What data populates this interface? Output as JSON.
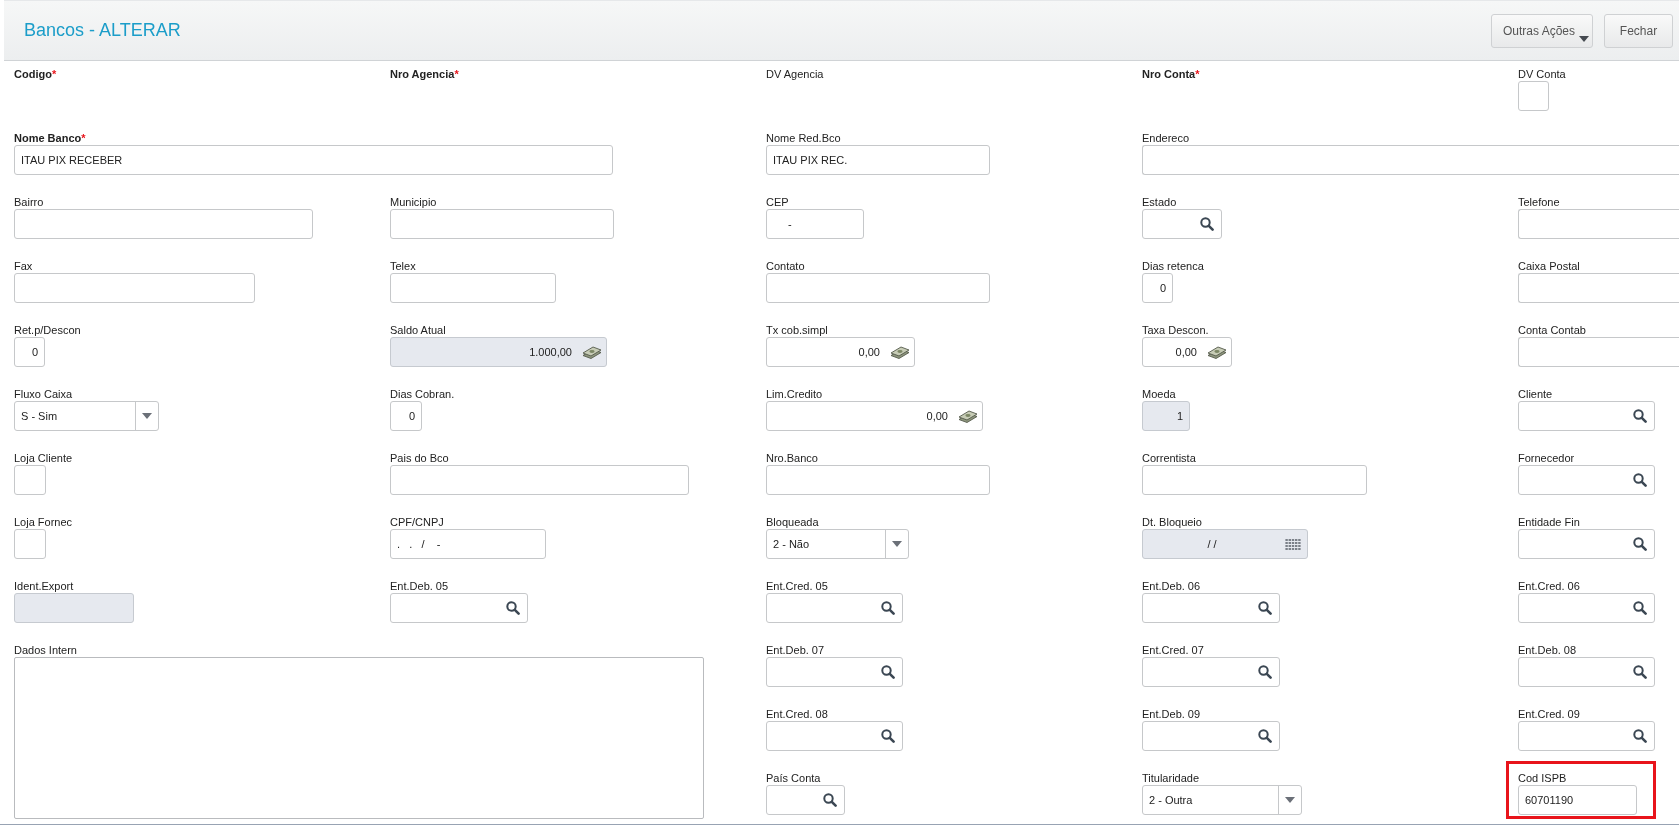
{
  "header": {
    "title": "Bancos - ALTERAR",
    "buttons": [
      {
        "label": "Outras Ações",
        "kind": "menu"
      },
      {
        "label": "Fechar",
        "kind": "plain"
      }
    ]
  },
  "form": {
    "fields": [
      {
        "label": "Codigo",
        "required_mark": "*",
        "kind": "none"
      },
      {
        "label": "Nro Agencia",
        "required_mark": "*",
        "kind": "none"
      },
      {
        "label": "DV Agencia",
        "kind": "none"
      },
      {
        "label": "Nro Conta",
        "required_mark": "*",
        "kind": "none"
      },
      {
        "label": "DV Conta",
        "kind": "text",
        "disabled": false
      },
      {
        "label": "Nome Banco",
        "required_mark": "*",
        "kind": "text",
        "value": "ITAU PIX RECEBER",
        "disabled": false
      },
      {
        "label": "Nome Red.Bco",
        "kind": "text",
        "value": "ITAU PIX REC.",
        "disabled": false
      },
      {
        "label": "Endereco",
        "kind": "text",
        "disabled": false
      },
      {
        "label": "Bairro",
        "kind": "text",
        "disabled": false
      },
      {
        "label": "Municipio",
        "kind": "text",
        "disabled": false
      },
      {
        "label": "CEP",
        "kind": "text",
        "value": "-",
        "disabled": false
      },
      {
        "label": "Estado",
        "kind": "search",
        "disabled": false
      },
      {
        "label": "Telefone",
        "kind": "text",
        "disabled": false
      },
      {
        "label": "Fax",
        "kind": "text",
        "disabled": false
      },
      {
        "label": "Telex",
        "kind": "text",
        "disabled": false
      },
      {
        "label": "Contato",
        "kind": "text",
        "disabled": false
      },
      {
        "label": "Dias retenca",
        "kind": "text",
        "value": "0",
        "disabled": false
      },
      {
        "label": "Caixa Postal",
        "kind": "text",
        "disabled": false
      },
      {
        "label": "Ret.p/Descon",
        "kind": "text",
        "value": "0",
        "disabled": false
      },
      {
        "label": "Saldo Atual",
        "kind": "money",
        "value": "1.000,00",
        "disabled": true
      },
      {
        "label": "Tx cob.simpl",
        "kind": "money",
        "value": "0,00",
        "disabled": false
      },
      {
        "label": "Taxa Descon.",
        "kind": "money",
        "value": "0,00",
        "disabled": false
      },
      {
        "label": "Conta Contab",
        "kind": "text",
        "disabled": false
      },
      {
        "label": "Fluxo Caixa",
        "kind": "select",
        "value": "S - Sim",
        "disabled": false
      },
      {
        "label": "Dias Cobran.",
        "kind": "text",
        "value": "0",
        "disabled": false
      },
      {
        "label": "Lim.Credito",
        "kind": "money",
        "value": "0,00",
        "disabled": false
      },
      {
        "label": "Moeda",
        "kind": "text",
        "value": "1",
        "disabled": true
      },
      {
        "label": "Cliente",
        "kind": "search",
        "disabled": false
      },
      {
        "label": "Loja Cliente",
        "kind": "text",
        "disabled": false
      },
      {
        "label": "Pais do Bco",
        "kind": "text",
        "disabled": false
      },
      {
        "label": "Nro.Banco",
        "kind": "text",
        "disabled": false
      },
      {
        "label": "Correntista",
        "kind": "text",
        "disabled": false
      },
      {
        "label": "Fornecedor",
        "kind": "search",
        "disabled": false
      },
      {
        "label": "Loja Fornec",
        "kind": "text",
        "disabled": false
      },
      {
        "label": "CPF/CNPJ",
        "kind": "text",
        "value": ".   .   /    -",
        "disabled": false
      },
      {
        "label": "Bloqueada",
        "kind": "select",
        "value": "2 - Não",
        "disabled": false
      },
      {
        "label": "Dt. Bloqueio",
        "kind": "date",
        "value": "/ /",
        "disabled": true
      },
      {
        "label": "Entidade Fin",
        "kind": "search",
        "disabled": false
      },
      {
        "label": "Ident.Export",
        "kind": "text",
        "disabled": true
      },
      {
        "label": "Ent.Deb. 05",
        "kind": "search",
        "disabled": false
      },
      {
        "label": "Ent.Cred. 05",
        "kind": "search",
        "disabled": false
      },
      {
        "label": "Ent.Deb. 06",
        "kind": "search",
        "disabled": false
      },
      {
        "label": "Ent.Cred. 06",
        "kind": "search",
        "disabled": false
      },
      {
        "label": "Dados Intern",
        "kind": "textarea",
        "disabled": false
      },
      {
        "label": "Ent.Deb. 07",
        "kind": "search",
        "disabled": false
      },
      {
        "label": "Ent.Cred. 07",
        "kind": "search",
        "disabled": false
      },
      {
        "label": "Ent.Deb. 08",
        "kind": "search",
        "disabled": false
      },
      {
        "label": "Ent.Cred. 08",
        "kind": "search",
        "disabled": false
      },
      {
        "label": "Ent.Deb. 09",
        "kind": "search",
        "disabled": false
      },
      {
        "label": "Ent.Cred. 09",
        "kind": "search",
        "disabled": false
      },
      {
        "label": "País Conta",
        "kind": "search",
        "disabled": false
      },
      {
        "label": "Titularidade",
        "kind": "select",
        "value": "2 - Outra",
        "disabled": false
      },
      {
        "label": "Cod ISPB",
        "kind": "text",
        "value": "60701190",
        "disabled": false,
        "highlighted": true
      }
    ]
  }
}
